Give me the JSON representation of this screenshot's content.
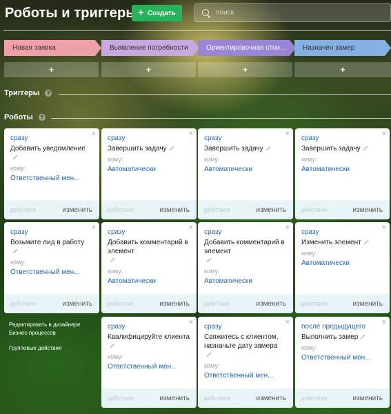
{
  "header": {
    "title": "Роботы и триггеры",
    "create_label": "Создать",
    "search_placeholder": "поиск"
  },
  "stages": [
    {
      "label": "Новая заявка",
      "color": "#f0a0a8",
      "text_color": "#333333"
    },
    {
      "label": "Выявление потребности",
      "color": "#c8a8e0",
      "text_color": "#333333"
    },
    {
      "label": "Ориентировочная стоимость",
      "color": "#9a84d8",
      "text_color": "#ffffff"
    },
    {
      "label": "Назначен замер",
      "color": "#86b0e4",
      "text_color": "#333333"
    }
  ],
  "add_label": "+",
  "sections": {
    "triggers": "Триггеры",
    "robots": "Роботы",
    "help": "?"
  },
  "card_labels": {
    "to": "кому:",
    "actions": "действия",
    "edit": "изменить",
    "close": "×"
  },
  "robots": [
    [
      {
        "when": "сразу",
        "name": "Добавить уведомление",
        "resp": "Ответственный мен..."
      },
      {
        "when": "сразу",
        "name": "Возьмите лид в работу",
        "resp": "Ответственный мен..."
      }
    ],
    [
      {
        "when": "сразу",
        "name": "Завершить задачу",
        "resp": "Автоматически"
      },
      {
        "when": "сразу",
        "name": "Добавить комментарий в элемент",
        "resp": "Автоматически"
      },
      {
        "when": "сразу",
        "name": "Квалифицируйте клиента",
        "resp": "Ответственный мен..."
      }
    ],
    [
      {
        "when": "сразу",
        "name": "Завершить задачу",
        "resp": "Автоматически"
      },
      {
        "when": "сразу",
        "name": "Добавить комментарий в элемент",
        "resp": "Автоматически"
      },
      {
        "when": "сразу",
        "name": "Свяжитесь с клиентом, назначьте дату замера",
        "resp": "Ответственный мен..."
      }
    ],
    [
      {
        "when": "сразу",
        "name": "Завершить задачу",
        "resp": "Автоматически"
      },
      {
        "when": "сразу",
        "name": "Изменить элемент",
        "resp": "Автоматически"
      },
      {
        "when": "после предыдущего",
        "name": "Выполнить замер",
        "resp": "Ответственный мен..."
      }
    ]
  ],
  "side_links": {
    "designer_line1": "Редактировать в дизайнере",
    "designer_line2": "Бизнес-процессов",
    "group": "Групповые действия"
  }
}
